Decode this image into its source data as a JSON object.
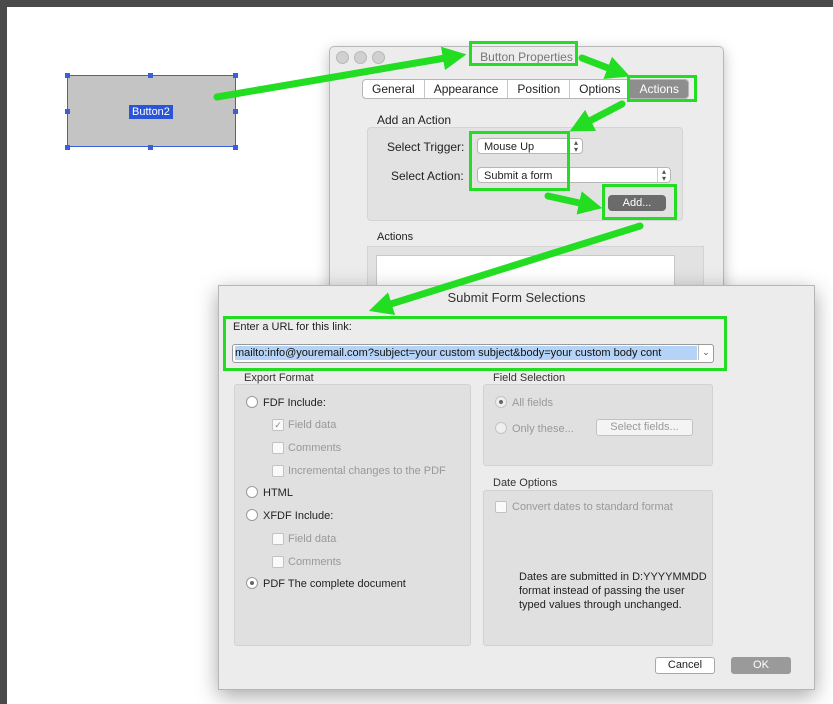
{
  "form_button": {
    "label": "Button2"
  },
  "button_properties": {
    "title": "Button Properties",
    "tabs": [
      "General",
      "Appearance",
      "Position",
      "Options",
      "Actions"
    ],
    "active_tab": "Actions",
    "add_action_heading": "Add an Action",
    "select_trigger_label": "Select Trigger:",
    "select_trigger_value": "Mouse Up",
    "select_action_label": "Select Action:",
    "select_action_value": "Submit a form",
    "add_button": "Add...",
    "actions_heading": "Actions"
  },
  "submit_form": {
    "title": "Submit Form Selections",
    "url_label": "Enter a URL for this link:",
    "url_value": "mailto:info@youremail.com?subject=your custom subject&body=your custom body cont",
    "export_format": {
      "title": "Export Format",
      "fdf_label": "FDF  Include:",
      "fdf_options": [
        {
          "label": "Field data",
          "checked": true
        },
        {
          "label": "Comments",
          "checked": false
        },
        {
          "label": "Incremental changes to the PDF",
          "checked": false
        }
      ],
      "html_label": "HTML",
      "xfdf_label": "XFDF  Include:",
      "xfdf_options": [
        {
          "label": "Field data",
          "checked": false
        },
        {
          "label": "Comments",
          "checked": false
        }
      ],
      "pdf_label": "PDF  The complete document",
      "selected": "PDF"
    },
    "field_selection": {
      "title": "Field Selection",
      "all_fields": "All fields",
      "only_these": "Only these...",
      "select_fields_button": "Select fields..."
    },
    "date_options": {
      "title": "Date Options",
      "convert_label": "Convert dates to standard format",
      "note": "Dates are submitted in D:YYYYMMDD format instead of passing the user typed values through unchanged."
    },
    "cancel_button": "Cancel",
    "ok_button": "OK"
  },
  "colors": {
    "highlight": "#22dd22",
    "selection_blue": "#2a55d8"
  }
}
